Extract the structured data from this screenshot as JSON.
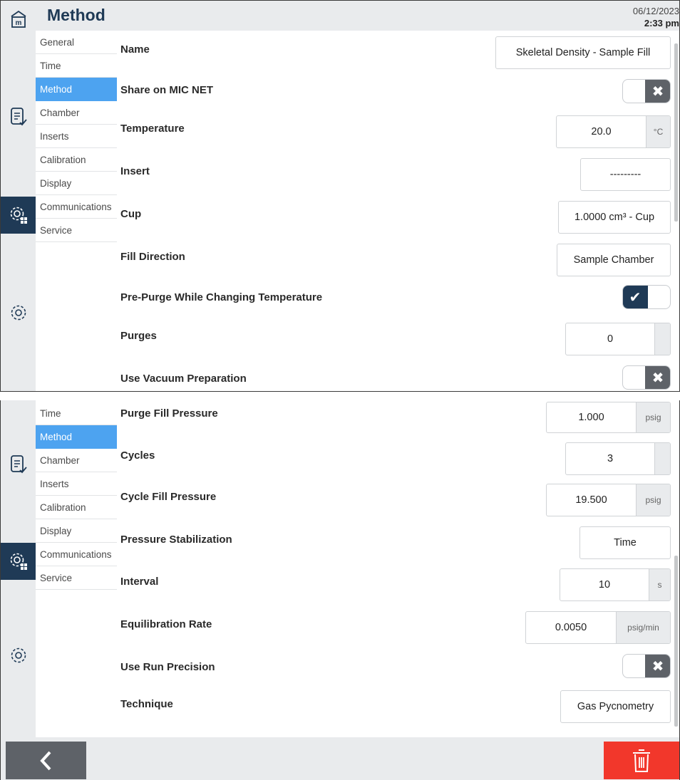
{
  "header": {
    "title": "Method",
    "date": "06/12/2023",
    "time": "2:33 pm"
  },
  "rail_icons": [
    "home-icon",
    "report-icon",
    "instrument-settings-icon",
    "settings-icon"
  ],
  "nav1": [
    "General",
    "Time",
    "Method",
    "Chamber",
    "Inserts",
    "Calibration",
    "Display",
    "Communications",
    "Service"
  ],
  "nav2": [
    "Time",
    "Method",
    "Chamber",
    "Inserts",
    "Calibration",
    "Display",
    "Communications",
    "Service"
  ],
  "selected_nav": "Method",
  "fields1": {
    "name": {
      "label": "Name",
      "value": "Skeletal Density - Sample Fill"
    },
    "share": {
      "label": "Share on MIC NET",
      "state": "off"
    },
    "temperature": {
      "label": "Temperature",
      "value": "20.0",
      "unit": "°C"
    },
    "insert": {
      "label": "Insert",
      "value": "---------"
    },
    "cup": {
      "label": "Cup",
      "value": "1.0000 cm³ - Cup"
    },
    "fill_direction": {
      "label": "Fill Direction",
      "value": "Sample Chamber"
    },
    "pre_purge": {
      "label": "Pre-Purge While Changing Temperature",
      "state": "on"
    },
    "purges": {
      "label": "Purges",
      "value": "0"
    },
    "vacuum_prep": {
      "label": "Use Vacuum Preparation",
      "state": "off"
    }
  },
  "fields2": {
    "purge_fill_pressure": {
      "label": "Purge Fill Pressure",
      "value": "1.000",
      "unit": "psig"
    },
    "cycles": {
      "label": "Cycles",
      "value": "3"
    },
    "cycle_fill_pressure": {
      "label": "Cycle Fill Pressure",
      "value": "19.500",
      "unit": "psig"
    },
    "pressure_stabilization": {
      "label": "Pressure Stabilization",
      "value": "Time"
    },
    "interval": {
      "label": "Interval",
      "value": "10",
      "unit": "s"
    },
    "equilibration_rate": {
      "label": "Equilibration Rate",
      "value": "0.0050",
      "unit": "psig/min"
    },
    "run_precision": {
      "label": "Use Run Precision",
      "state": "off"
    },
    "technique": {
      "label": "Technique",
      "value": "Gas Pycnometry"
    }
  },
  "colors": {
    "navy": "#1f3a56",
    "selected": "#4da3f0",
    "rail": "#e9ebed",
    "delete": "#f2372b",
    "back": "#5e6268"
  }
}
